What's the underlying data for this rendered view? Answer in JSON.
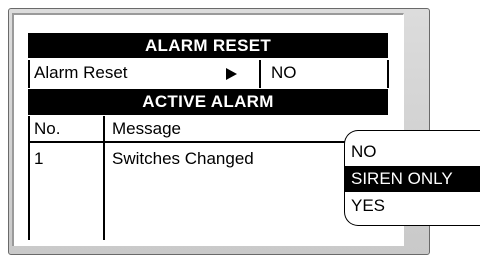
{
  "screen": {
    "title": "ALARM RESET",
    "reset": {
      "label": "Alarm Reset",
      "value": "NO"
    },
    "active_title": "ACTIVE ALARM",
    "table": {
      "headers": [
        "No.",
        "Message"
      ],
      "rows": [
        {
          "no": "1",
          "message": "Switches Changed"
        }
      ]
    }
  },
  "popup": {
    "options": [
      "NO",
      "SIREN ONLY",
      "YES"
    ],
    "selected": "SIREN ONLY"
  }
}
